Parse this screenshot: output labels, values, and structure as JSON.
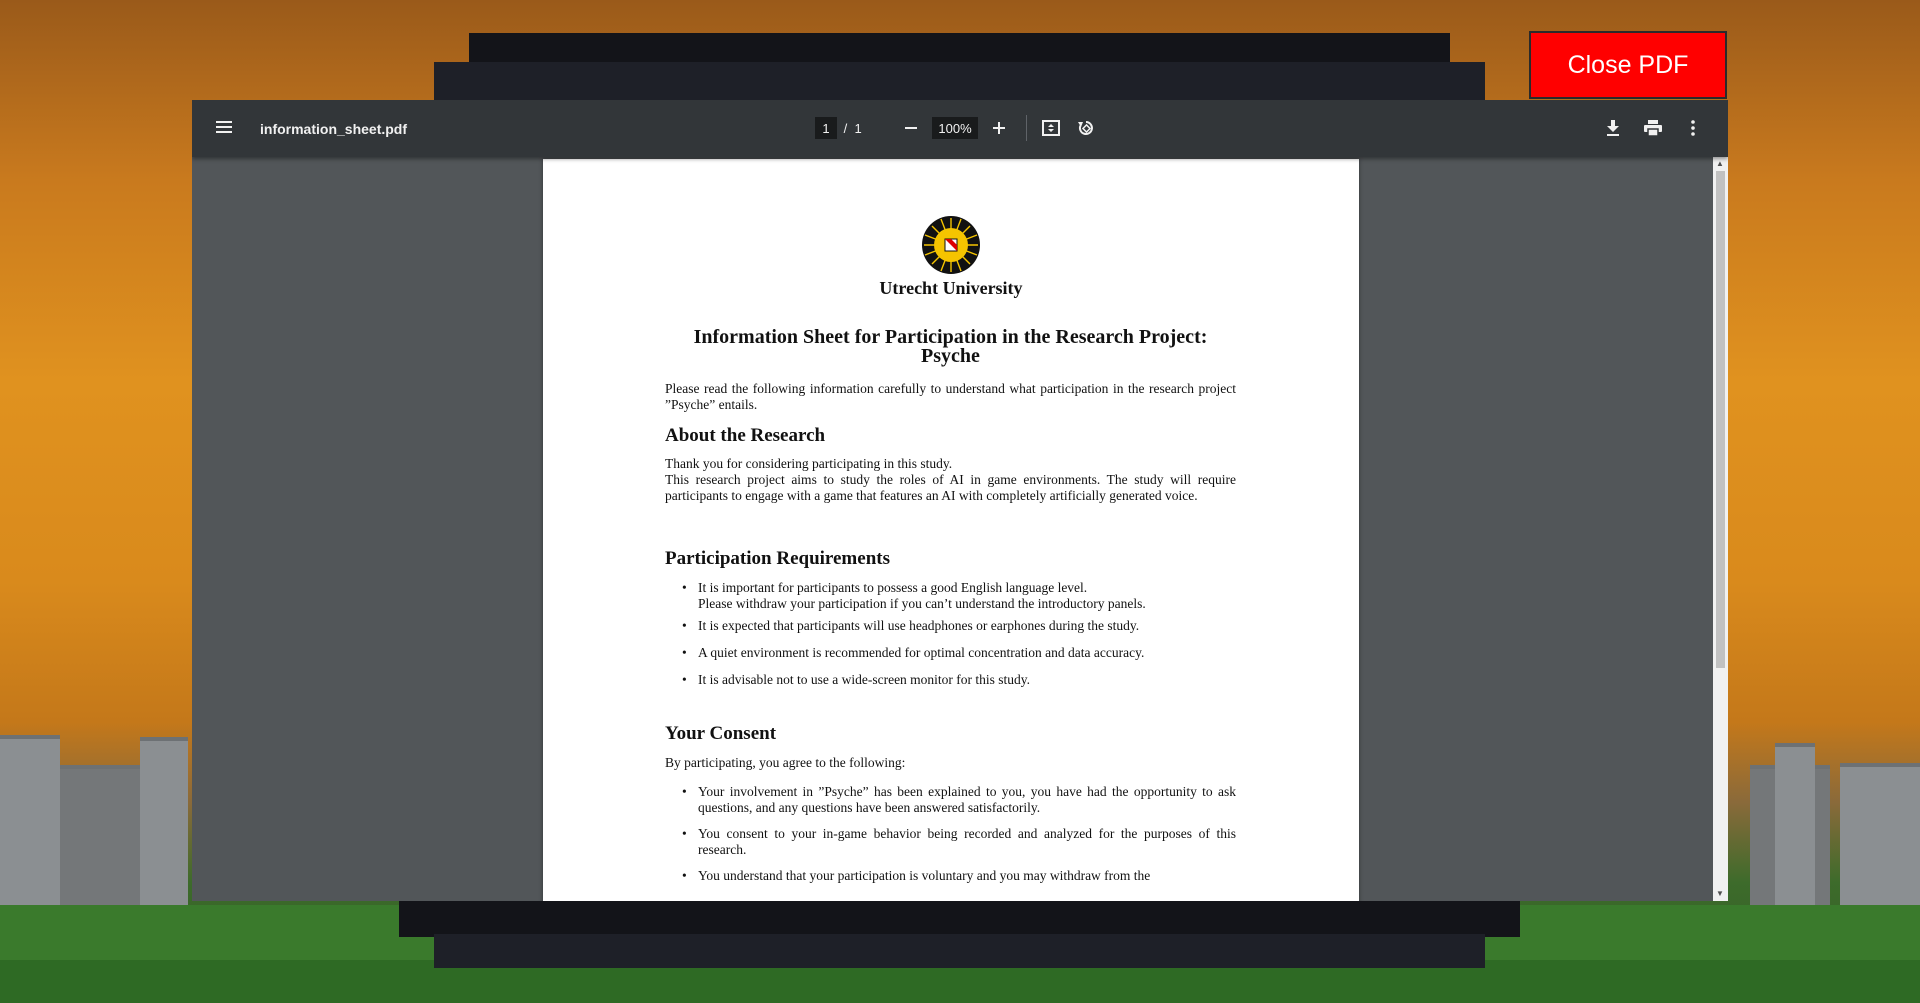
{
  "close_button": {
    "label": "Close PDF",
    "color": "#ff0000"
  },
  "toolbar": {
    "filename": "information_sheet.pdf",
    "current_page": "1",
    "page_separator": "/",
    "total_pages": "1",
    "zoom": "100%",
    "icons": [
      "menu-icon",
      "zoom-out-icon",
      "zoom-in-icon",
      "fit-page-icon",
      "rotate-icon",
      "download-icon",
      "print-icon",
      "more-options-icon"
    ]
  },
  "document": {
    "institution": "Utrecht University",
    "title_line1": "Information Sheet for Participation in the Research Project:",
    "title_line2": "Psyche",
    "intro": "Please read the following information carefully to understand what participation in the research project ”Psyche” entails.",
    "about": {
      "heading": "About the Research",
      "line1": "Thank you for considering participating in this study.",
      "line2": "This research project aims to study the roles of AI in game environments. The study will require participants to engage with a game that features an AI with completely artificially generated voice."
    },
    "requirements": {
      "heading": "Participation Requirements",
      "item1_line1": "It is important for participants to possess a good English language level.",
      "item1_line2": "Please withdraw your participation if you can’t understand the introductory panels.",
      "item2": "It is expected that participants will use headphones or earphones during the study.",
      "item3": "A quiet environment is recommended for optimal concentration and data accuracy.",
      "item4": "It is advisable not to use a wide-screen monitor for this study."
    },
    "consent": {
      "heading": "Your Consent",
      "intro": "By participating, you agree to the following:",
      "item1": "Your involvement in ”Psyche” has been explained to you, you have had the opportunity to ask questions, and any questions have been answered satisfactorily.",
      "item2": "You consent to your in-game behavior being recorded and analyzed for the purposes of this research.",
      "item3": "You understand that your participation is voluntary and you may withdraw from the"
    }
  }
}
